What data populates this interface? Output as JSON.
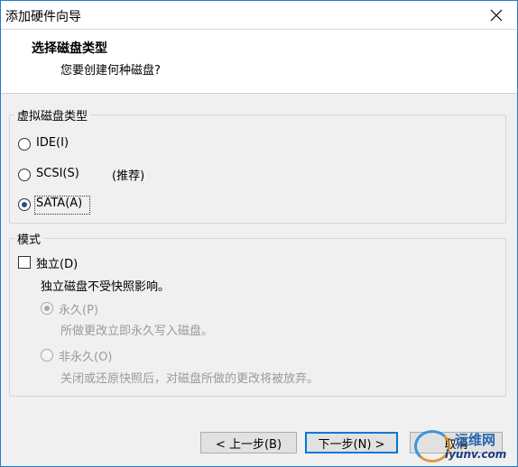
{
  "window": {
    "title": "添加硬件向导"
  },
  "header": {
    "title": "选择磁盘类型",
    "subtitle": "您要创建何种磁盘?"
  },
  "disk_type": {
    "group_label": "虚拟磁盘类型",
    "options": [
      {
        "label": "IDE(I)",
        "checked": false
      },
      {
        "label": "SCSI(S)",
        "note": "(推荐)",
        "checked": false
      },
      {
        "label": "SATA(A)",
        "checked": true
      }
    ]
  },
  "mode": {
    "group_label": "模式",
    "independent_label": "独立(D)",
    "independent_desc": "独立磁盘不受快照影响。",
    "persistent_label": "永久(P)",
    "persistent_desc": "所做更改立即永久写入磁盘。",
    "nonpersistent_label": "非永久(O)",
    "nonpersistent_desc": "关闭或还原快照后，对磁盘所做的更改将被放弃。"
  },
  "buttons": {
    "back": "< 上一步(B)",
    "next": "下一步(N) >",
    "cancel": "取消"
  },
  "watermark": {
    "line1": "运维网",
    "line2": "iyunv.com"
  }
}
